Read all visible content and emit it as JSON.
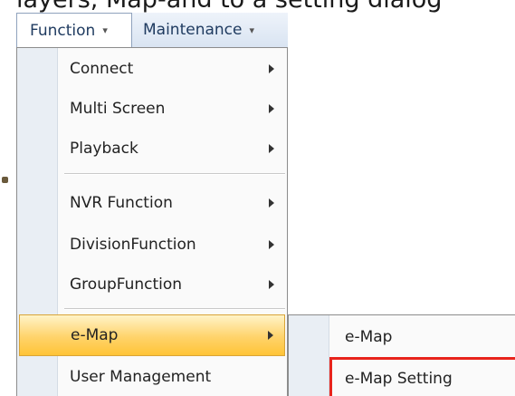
{
  "background_text": "layers, Map-and to a setting dialog",
  "menubar": {
    "items": [
      {
        "label": "Function"
      },
      {
        "label": "Maintenance"
      }
    ]
  },
  "menu": {
    "items": [
      {
        "label": "Connect",
        "submenu": true
      },
      {
        "label": "Multi Screen",
        "submenu": true
      },
      {
        "label": "Playback",
        "submenu": true
      },
      {
        "label": "NVR Function",
        "submenu": true
      },
      {
        "label": "DivisionFunction",
        "submenu": true
      },
      {
        "label": "GroupFunction",
        "submenu": true
      },
      {
        "label": "e-Map",
        "submenu": true,
        "highlighted": true
      },
      {
        "label": "User Management",
        "submenu": false
      }
    ]
  },
  "submenu": {
    "items": [
      {
        "label": "e-Map"
      },
      {
        "label": "e-Map Setting",
        "annotated": true
      }
    ]
  },
  "colors": {
    "annotation_box": "#e8241c",
    "hot_item": "#ffd36a"
  }
}
